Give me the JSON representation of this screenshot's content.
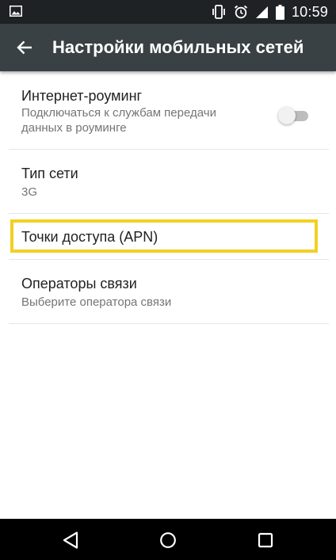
{
  "status_bar": {
    "time": "10:59",
    "left_icon": "image-notification-icon",
    "right_icons": [
      "vibrate-icon",
      "alarm-icon",
      "signal-icon",
      "battery-icon"
    ]
  },
  "toolbar": {
    "back_icon": "arrow-back-icon",
    "title": "Настройки мобильных сетей"
  },
  "preferences": [
    {
      "title": "Интернет-роуминг",
      "summary_line1": "Подключаться к службам передачи",
      "summary_line2": "данных в роуминге",
      "toggle_on": false
    },
    {
      "title": "Тип сети",
      "summary": "3G"
    },
    {
      "title": "Точки доступа (APN)",
      "highlighted": true,
      "highlight_color": "#f2d024"
    },
    {
      "title": "Операторы связи",
      "summary": "Выберите оператора связи"
    }
  ],
  "nav_bar": {
    "buttons": [
      "back-triangle-icon",
      "home-circle-icon",
      "recents-square-icon"
    ]
  },
  "colors": {
    "status_bar": "#1e2224",
    "toolbar": "#3a4144",
    "title_text": "#212121",
    "summary_text": "#757575"
  }
}
